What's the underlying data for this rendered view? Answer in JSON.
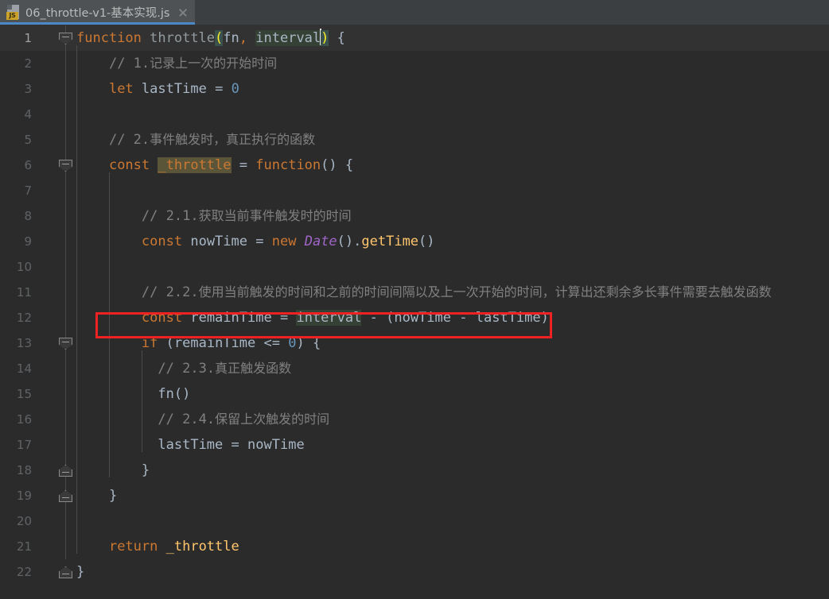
{
  "window": {
    "app": "code-editor",
    "theme_colors": {
      "editor_background": "#2b2b2b",
      "current_line_background": "#323232",
      "tab_background": "#4e5254",
      "tabbar_background": "#3c3f41",
      "tab_underline": "#4a88c7",
      "keyword": "#cc7832",
      "number": "#6897bb",
      "comment": "#808080",
      "class_name": "#a064c8",
      "method": "#ffc66d",
      "identifier": "#a9b7c6",
      "identifier_highlight": "#344134",
      "write_highlight": "#5a5438",
      "bracket_match": "#3b514d",
      "annotation_box": "#ee2222"
    }
  },
  "tabbar": {
    "tabs": [
      {
        "title": "06_throttle-v1-基本实现.js",
        "icon": "js-file-icon",
        "icon_label": "JS",
        "close_icon": "close-icon",
        "active": true
      }
    ]
  },
  "editor": {
    "current_line": 1,
    "annotation": {
      "type": "rectangle",
      "color": "#ee2222",
      "target_line": 12
    },
    "lines": [
      {
        "n": "1",
        "fold": "start",
        "current": true
      },
      {
        "n": "2",
        "fold": "none"
      },
      {
        "n": "3",
        "fold": "none"
      },
      {
        "n": "4",
        "fold": "none"
      },
      {
        "n": "5",
        "fold": "none"
      },
      {
        "n": "6",
        "fold": "start"
      },
      {
        "n": "7",
        "fold": "none"
      },
      {
        "n": "8",
        "fold": "none"
      },
      {
        "n": "9",
        "fold": "none"
      },
      {
        "n": "10",
        "fold": "none"
      },
      {
        "n": "11",
        "fold": "none"
      },
      {
        "n": "12",
        "fold": "none"
      },
      {
        "n": "13",
        "fold": "start"
      },
      {
        "n": "14",
        "fold": "none"
      },
      {
        "n": "15",
        "fold": "none"
      },
      {
        "n": "16",
        "fold": "none"
      },
      {
        "n": "17",
        "fold": "none"
      },
      {
        "n": "18",
        "fold": "end"
      },
      {
        "n": "19",
        "fold": "end"
      },
      {
        "n": "20",
        "fold": "none"
      },
      {
        "n": "21",
        "fold": "none"
      },
      {
        "n": "22",
        "fold": "end"
      }
    ],
    "code_text": [
      "function throttle(fn, interval) {",
      "    // 1.记录上一次的开始时间",
      "    let lastTime = 0",
      "",
      "    // 2.事件触发时，真正执行的函数",
      "    const _throttle = function() {",
      "",
      "        // 2.1.获取当前事件触发时的时间",
      "        const nowTime = new Date().getTime()",
      "",
      "        // 2.2.使用当前触发的时间和之前的时间间隔以及上一次开始的时间，计算出还剩余多长事件需要去触发函数",
      "        const remainTime = interval - (nowTime - lastTime)",
      "        if (remainTime <= 0) {",
      "            // 2.3.真正触发函数",
      "            fn()",
      "            // 2.4.保留上次触发的时间",
      "            lastTime = nowTime",
      "        }",
      "    }",
      "",
      "    return _throttle",
      "}"
    ]
  }
}
